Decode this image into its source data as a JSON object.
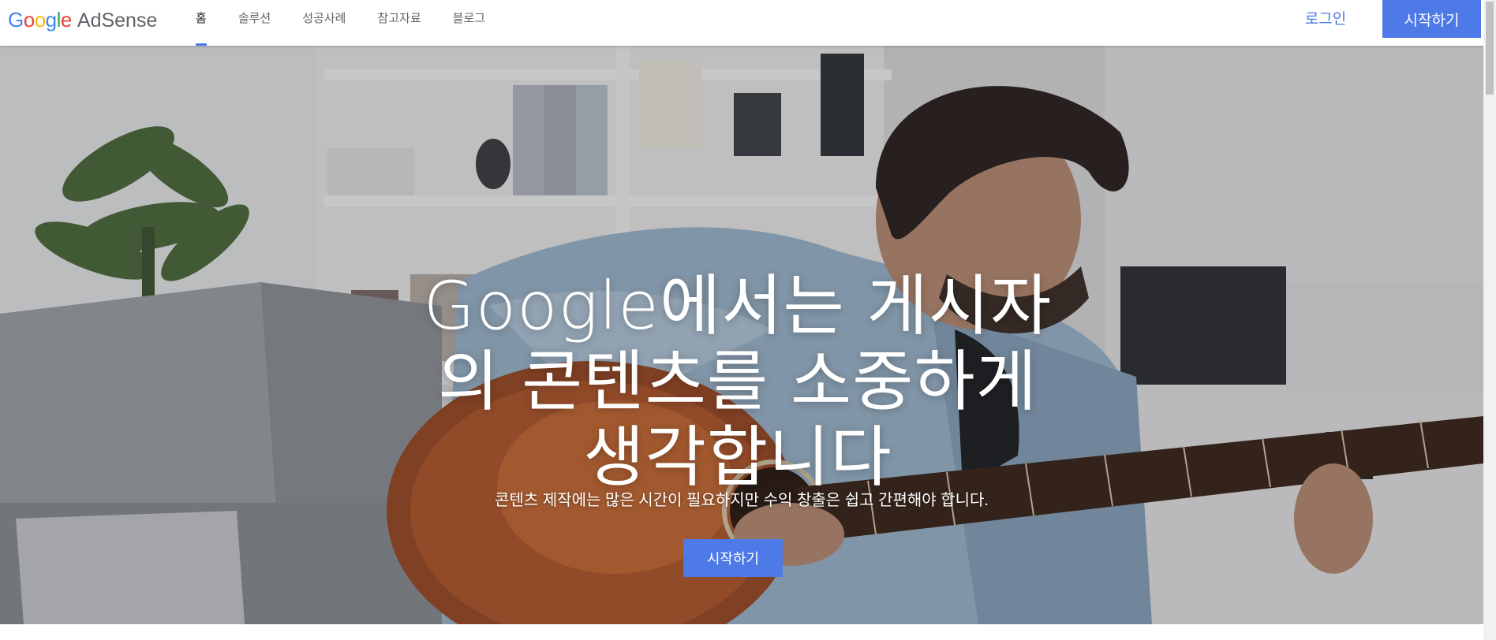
{
  "header": {
    "logo_google": [
      "G",
      "o",
      "o",
      "g",
      "l",
      "e"
    ],
    "logo_colors": [
      "#4285f4",
      "#ea4335",
      "#fbbc05",
      "#4285f4",
      "#34a853",
      "#ea4335"
    ],
    "logo_product": "AdSense",
    "nav": [
      {
        "label": "홈",
        "active": true
      },
      {
        "label": "솔루션",
        "active": false
      },
      {
        "label": "성공사례",
        "active": false
      },
      {
        "label": "참고자료",
        "active": false
      },
      {
        "label": "블로그",
        "active": false
      }
    ],
    "login_label": "로그인",
    "start_label": "시작하기"
  },
  "hero": {
    "title_lines": [
      "Google에서는 게시자",
      "의 콘텐츠를 소중하게",
      "생각합니다"
    ],
    "subtitle": "콘텐츠 제작에는 많은 시간이 필요하지만 수익 창출은 쉽고 간편해야 합니다.",
    "cta_label": "시작하기",
    "image": "man-playing-guitar-photo"
  },
  "colors": {
    "accent": "#4e7ae8",
    "nav_active": "#202124",
    "nav_text": "#5f6368"
  }
}
